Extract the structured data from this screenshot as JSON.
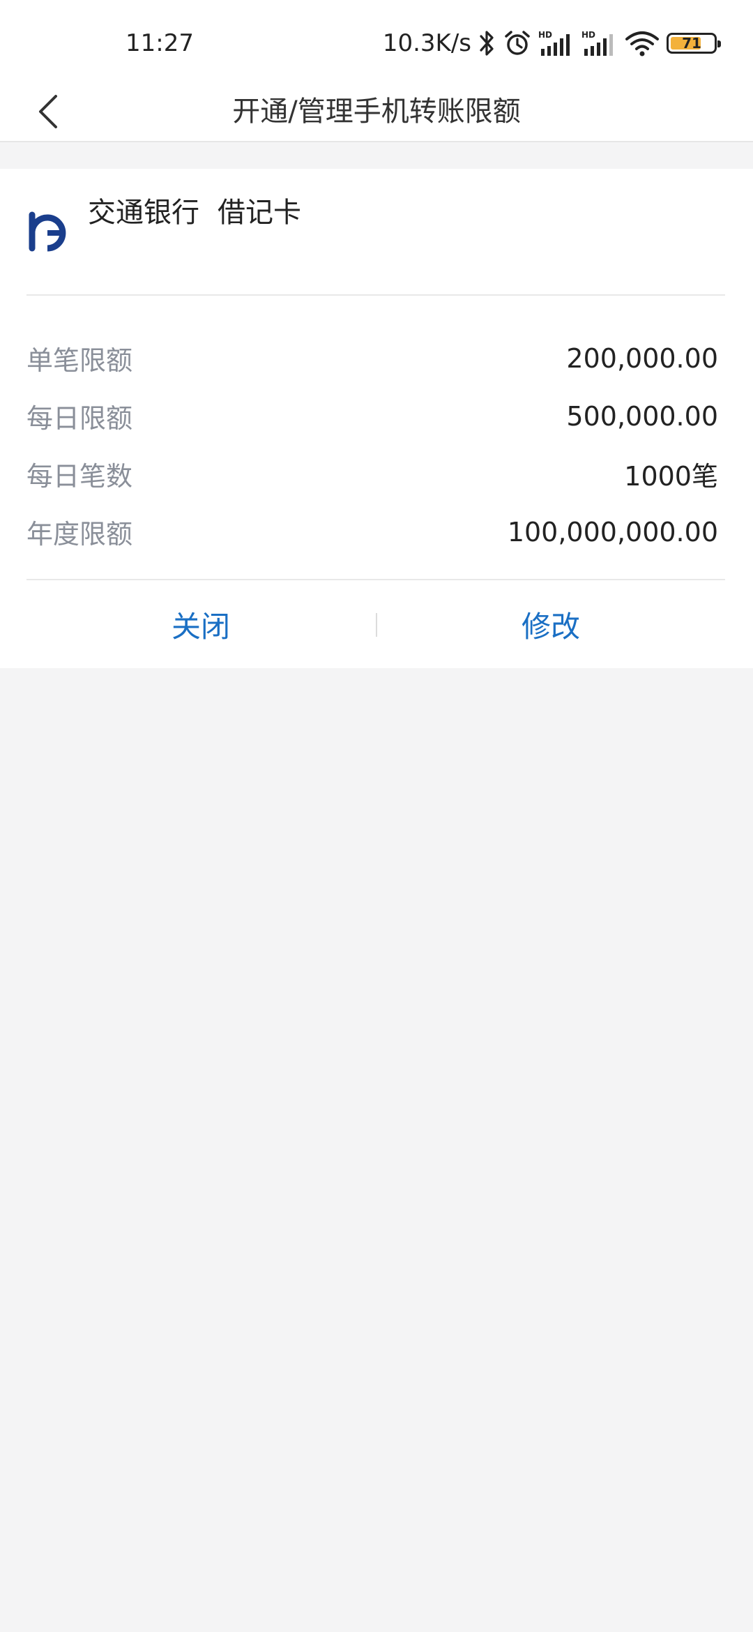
{
  "status_bar": {
    "time": "11:27",
    "net_speed": "10.3K/s",
    "battery_level": "71",
    "battery_fraction": 0.71,
    "icons": [
      "bluetooth-icon",
      "alarm-icon",
      "signal-hd-icon",
      "signal-hd-icon",
      "wifi-icon",
      "battery-icon"
    ]
  },
  "nav": {
    "title": "开通/管理手机转账限额",
    "back_icon": "chevron-left-icon"
  },
  "card": {
    "bank_name": "交通银行",
    "card_type": "借记卡",
    "logo_icon": "bank-logo-icon",
    "brand_color": "#1a3e8c",
    "rows": [
      {
        "label": "单笔限额",
        "value": "200,000.00"
      },
      {
        "label": "每日限额",
        "value": "500,000.00"
      },
      {
        "label": "每日笔数",
        "value": "1000笔"
      },
      {
        "label": "年度限额",
        "value": "100,000,000.00"
      }
    ],
    "buttons": {
      "close": "关闭",
      "modify": "修改"
    }
  },
  "colors": {
    "accent": "#1a6fc4",
    "label_gray": "#8a8f99",
    "background": "#f4f4f5",
    "battery": "#f3b13b"
  }
}
